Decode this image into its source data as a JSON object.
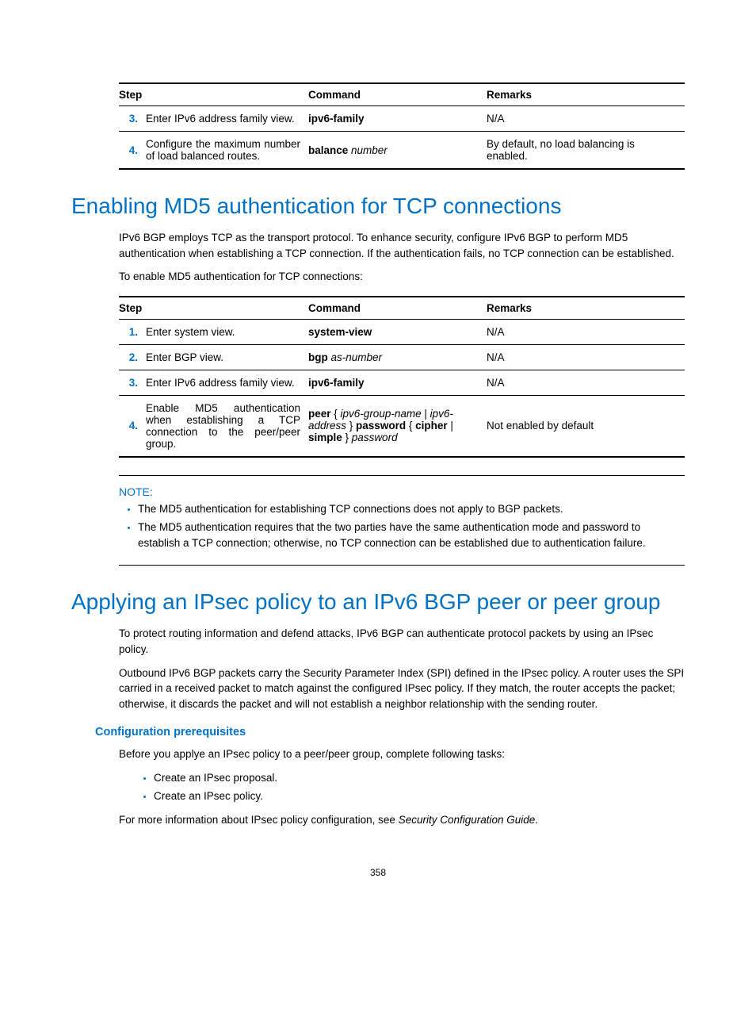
{
  "table1": {
    "headers": {
      "step": "Step",
      "command": "Command",
      "remarks": "Remarks"
    },
    "rows": [
      {
        "num": "3.",
        "desc": "Enter IPv6 address family view.",
        "cmd_parts": [
          {
            "t": "ipv6-family",
            "b": true
          }
        ],
        "remarks": "N/A"
      },
      {
        "num": "4.",
        "desc": "Configure the maximum number of load balanced routes.",
        "cmd_parts": [
          {
            "t": "balance ",
            "b": true
          },
          {
            "t": "number",
            "i": true
          }
        ],
        "remarks": "By default, no load balancing is enabled."
      }
    ]
  },
  "section_md5": {
    "heading": "Enabling MD5 authentication for TCP connections",
    "p1": "IPv6 BGP employs TCP as the transport protocol. To enhance security, configure IPv6 BGP to perform MD5 authentication when establishing a TCP connection. If the authentication fails, no TCP connection can be established.",
    "p2": "To enable MD5 authentication for TCP connections:"
  },
  "table2": {
    "headers": {
      "step": "Step",
      "command": "Command",
      "remarks": "Remarks"
    },
    "rows": [
      {
        "num": "1.",
        "desc": "Enter system view.",
        "cmd_parts": [
          {
            "t": "system-view",
            "b": true
          }
        ],
        "remarks": "N/A"
      },
      {
        "num": "2.",
        "desc": "Enter BGP view.",
        "cmd_parts": [
          {
            "t": "bgp ",
            "b": true
          },
          {
            "t": "as-number",
            "i": true
          }
        ],
        "remarks": "N/A"
      },
      {
        "num": "3.",
        "desc": "Enter IPv6 address family view.",
        "cmd_parts": [
          {
            "t": "ipv6-family",
            "b": true
          }
        ],
        "remarks": "N/A"
      },
      {
        "num": "4.",
        "desc": "Enable MD5 authentication when establishing a TCP connection to the peer/peer group.",
        "cmd_parts": [
          {
            "t": "peer",
            "b": true
          },
          {
            "t": " { "
          },
          {
            "t": "ipv6-group-name",
            "i": true
          },
          {
            "t": " | "
          },
          {
            "t": "ipv6-address",
            "i": true
          },
          {
            "t": " } "
          },
          {
            "t": "password",
            "b": true
          },
          {
            "t": " { "
          },
          {
            "t": "cipher",
            "b": true
          },
          {
            "t": " | "
          },
          {
            "t": "simple",
            "b": true
          },
          {
            "t": " } "
          },
          {
            "t": "password",
            "i": true
          }
        ],
        "remarks": "Not enabled by default"
      }
    ]
  },
  "note": {
    "label": "NOTE:",
    "items": [
      "The MD5 authentication for establishing TCP connections does not apply to BGP packets.",
      "The MD5 authentication requires that the two parties have the same authentication mode and password to establish a TCP connection; otherwise, no TCP connection can be established due to authentication failure."
    ]
  },
  "section_ipsec": {
    "heading": "Applying an IPsec policy to an IPv6 BGP peer or peer group",
    "p1": "To protect routing information and defend attacks, IPv6 BGP can authenticate protocol packets by using an IPsec policy.",
    "p2": "Outbound IPv6 BGP packets carry the Security Parameter Index (SPI) defined in the IPsec policy. A router uses the SPI carried in a received packet to match against the configured IPsec policy. If they match, the router accepts the packet; otherwise, it discards the packet and will not establish a neighbor relationship with the sending router.",
    "subhead": "Configuration prerequisites",
    "p3": "Before you applye an IPsec policy to a peer/peer group, complete following tasks:",
    "bullets": [
      "Create an IPsec proposal.",
      "Create an IPsec policy."
    ],
    "p4_pre": "For more information about IPsec policy configuration, see ",
    "p4_em": "Security Configuration Guide",
    "p4_post": "."
  },
  "pagenum": "358"
}
